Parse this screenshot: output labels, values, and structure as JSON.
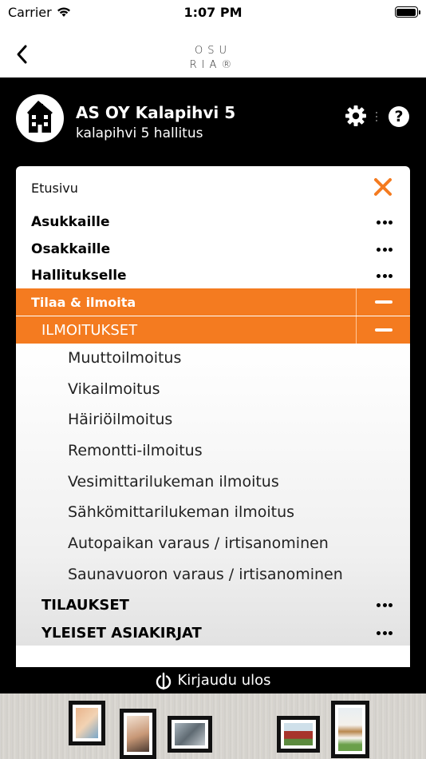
{
  "status_bar": {
    "carrier": "Carrier",
    "time": "1:07 PM"
  },
  "nav": {
    "brand_line1": "OSU",
    "brand_line2": "RIA®"
  },
  "header": {
    "company_name": "AS OY Kalapihvi 5",
    "subtitle": "kalapihvi 5 hallitus"
  },
  "menu": {
    "home_label": "Etusivu",
    "sections": [
      {
        "label": "Asukkaille"
      },
      {
        "label": "Osakkaille"
      },
      {
        "label": "Hallitukselle"
      }
    ],
    "active_section": "Tilaa & ilmoita",
    "active_subsection": "ILMOITUKSET",
    "items": [
      "Muuttoilmoitus",
      "Vikailmoitus",
      "Häiriöilmoitus",
      "Remontti-ilmoitus",
      "Vesimittarilukeman ilmoitus",
      "Sähkömittarilukeman ilmoitus",
      "Autopaikan varaus / irtisanominen",
      "Saunavuoron varaus / irtisanominen"
    ],
    "other_subsections": [
      {
        "label": "TILAUKSET"
      },
      {
        "label": "YLEISET ASIAKIRJAT"
      }
    ]
  },
  "footer": {
    "logout_label": "Kirjaudu ulos"
  },
  "colors": {
    "accent": "#f47b20",
    "header_bg": "#000000"
  }
}
